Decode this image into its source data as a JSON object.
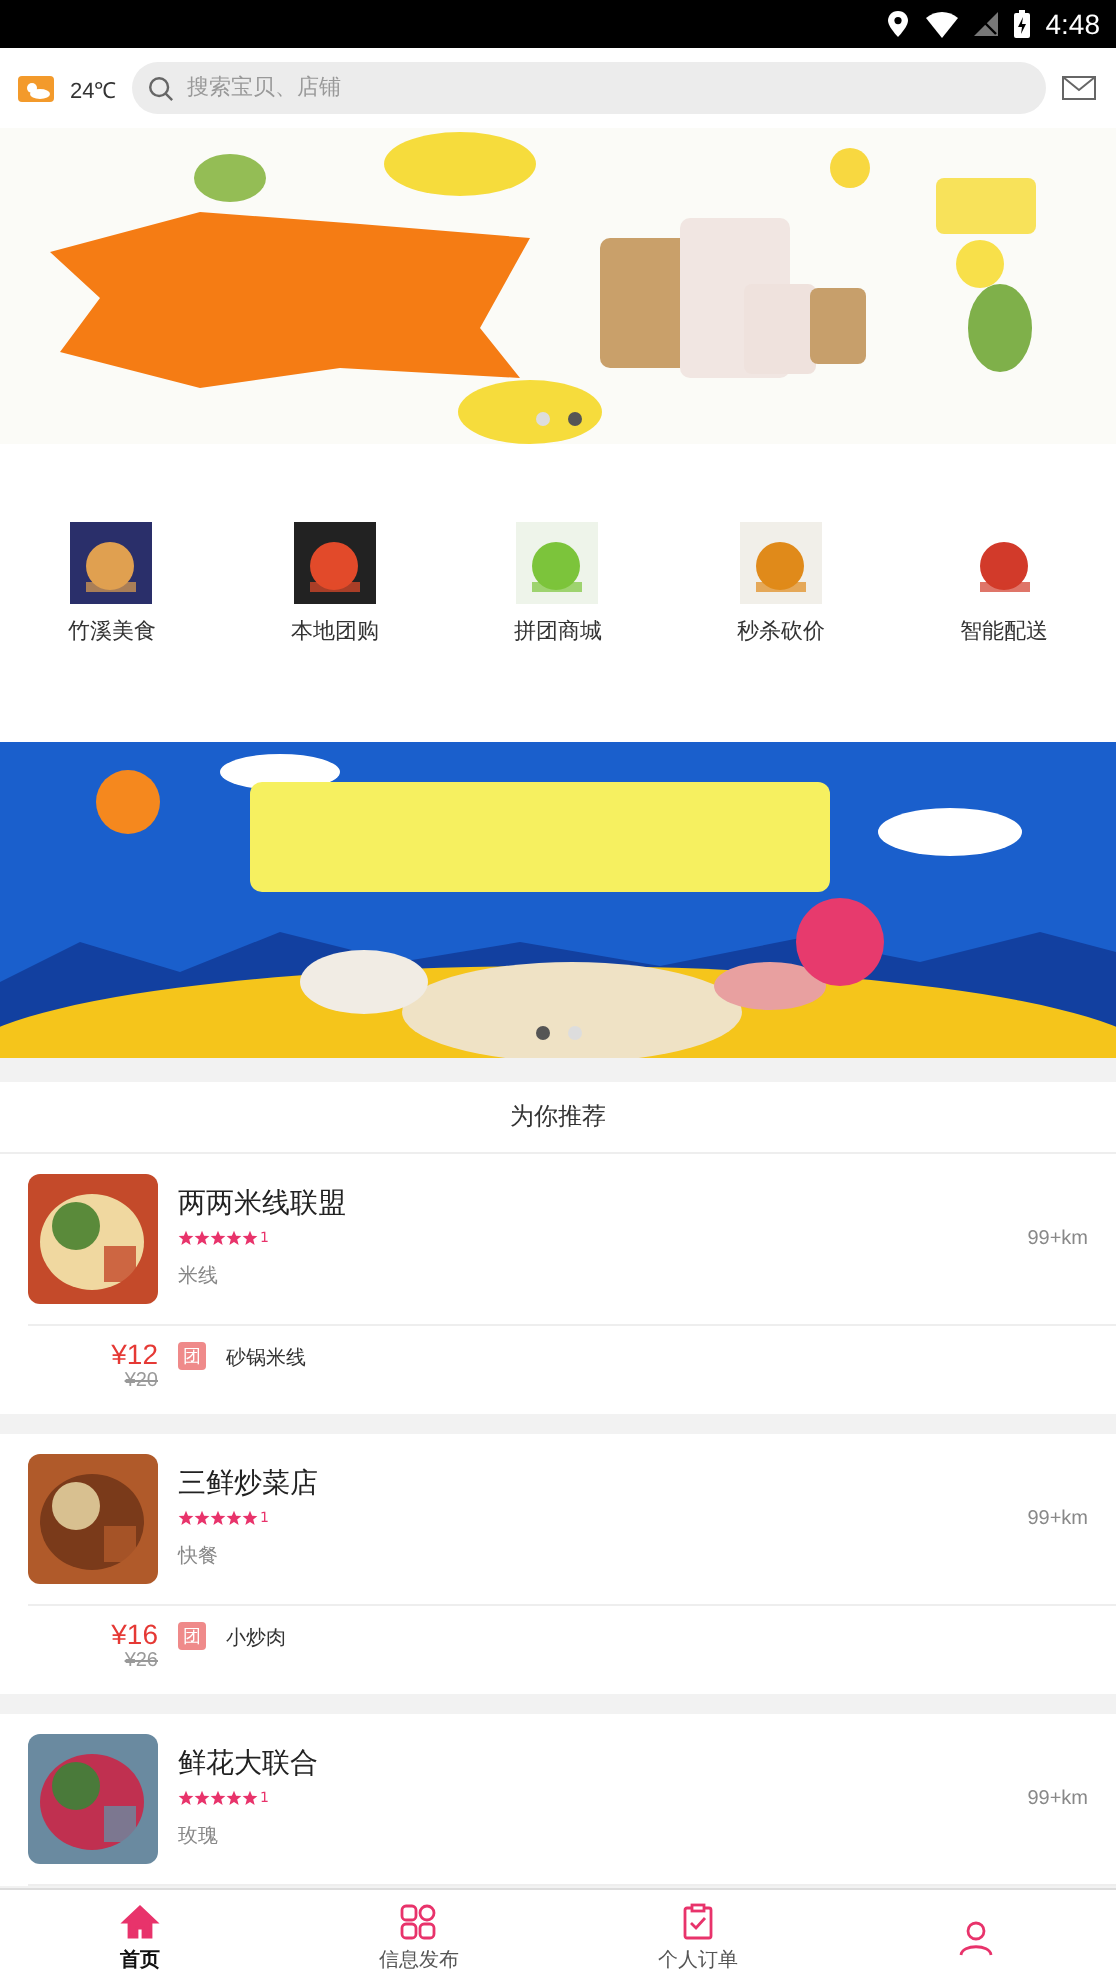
{
  "status_bar": {
    "time": "4:48"
  },
  "header": {
    "temperature": "24℃",
    "search": {
      "placeholder": "搜索宝贝、店铺"
    }
  },
  "top_banner": {
    "dots": [
      {
        "selected": false
      },
      {
        "selected": true
      }
    ]
  },
  "categories": [
    {
      "label": "竹溪美食"
    },
    {
      "label": "本地团购"
    },
    {
      "label": "拼团商城"
    },
    {
      "label": "秒杀砍价"
    },
    {
      "label": "智能配送"
    }
  ],
  "middle_banner": {
    "dots": [
      {
        "selected": true
      },
      {
        "selected": false
      }
    ]
  },
  "section_title": "为你推荐",
  "shops": [
    {
      "name": "两两米线联盟",
      "stars": 5,
      "score": "1",
      "category": "米线",
      "distance": "99+km",
      "price": "¥12",
      "old_price": "¥20",
      "tag": "团",
      "deal": "砂锅米线"
    },
    {
      "name": "三鲜炒菜店",
      "stars": 5,
      "score": "1",
      "category": "快餐",
      "distance": "99+km",
      "price": "¥16",
      "old_price": "¥26",
      "tag": "团",
      "deal": "小炒肉"
    },
    {
      "name": "鲜花大联合",
      "stars": 5,
      "score": "1",
      "category": "玫瑰",
      "distance": "99+km"
    }
  ],
  "tab_bar": [
    {
      "label": "首页",
      "selected": true
    },
    {
      "label": "信息发布",
      "selected": false
    },
    {
      "label": "个人订单",
      "selected": false
    },
    {
      "selected": false
    }
  ]
}
